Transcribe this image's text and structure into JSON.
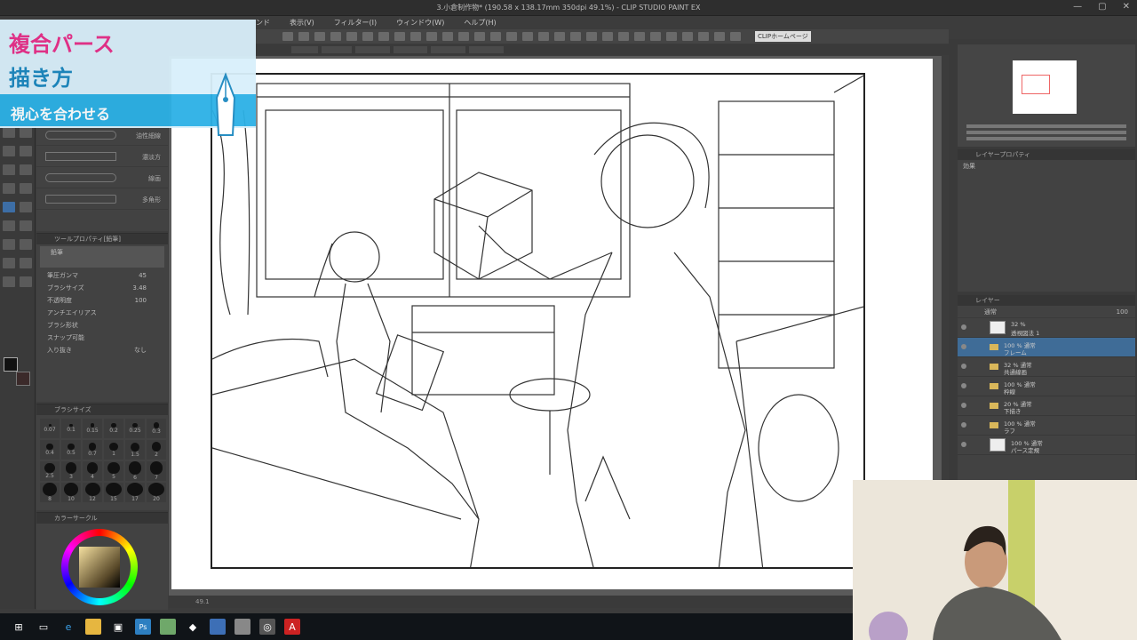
{
  "window": {
    "title": "3.小倉制作物* (190.58 x 138.17mm 350dpi 49.1%) - CLIP STUDIO PAINT EX",
    "controls": [
      "—",
      "▢",
      "✕"
    ]
  },
  "menu": {
    "items": [
      "ンド",
      "表示(V)",
      "フィルター(I)",
      "ウィンドウ(W)",
      "ヘルプ(H)"
    ]
  },
  "command_bar": {
    "clip_studio_label": "CLIPホームページ"
  },
  "overlay_card": {
    "line1": "複合パース",
    "line2": "描き方",
    "line3": "視心を合わせる"
  },
  "subtool_panel": {
    "brush_labels": [
      "油性細線",
      "濃淡方",
      "線画",
      "多角形"
    ]
  },
  "tool_property": {
    "header": "ツールプロパティ[鉛筆]",
    "preset": "鉛筆",
    "rows": [
      {
        "label": "筆圧ガンマ",
        "value": "45"
      },
      {
        "label": "ブラシサイズ",
        "value": "3.48"
      },
      {
        "label": "不透明度",
        "value": "100"
      },
      {
        "label": "アンチエイリアス",
        "value": ""
      },
      {
        "label": "ブラシ形状",
        "value": ""
      },
      {
        "label": "スナップ可能",
        "value": ""
      },
      {
        "label": "入り抜き",
        "value": "なし"
      }
    ]
  },
  "brush_size": {
    "header": "ブラシサイズ",
    "sizes": [
      "0.07",
      "0.1",
      "0.15",
      "0.2",
      "0.25",
      "0.3",
      "0.4",
      "0.5",
      "0.7",
      "1",
      "1.5",
      "2",
      "2.5",
      "3",
      "4",
      "5",
      "6",
      "7",
      "8",
      "10",
      "12",
      "15",
      "17",
      "20"
    ]
  },
  "color_panel": {
    "header": "カラーサークル"
  },
  "layer_property": {
    "header": "レイヤープロパティ",
    "effect_label": "効果"
  },
  "layers": {
    "header": "レイヤー",
    "blend_mode": "通常",
    "opacity": "100",
    "rows": [
      {
        "line1": "32 %",
        "line2": "透視図法 1",
        "selected": false
      },
      {
        "line1": "100 % 通常",
        "line2": "フレーム",
        "selected": true
      },
      {
        "line1": "32 % 通常",
        "line2": "共通線画",
        "selected": false
      },
      {
        "line1": "100 % 通常",
        "line2": "枠線",
        "selected": false
      },
      {
        "line1": "20 % 通常",
        "line2": "下描き",
        "selected": false
      },
      {
        "line1": "100 % 通常",
        "line2": "ラフ",
        "selected": false
      },
      {
        "line1": "100 % 通常",
        "line2": "パース定規",
        "selected": false
      }
    ]
  },
  "canvas": {
    "zoom": "49.1"
  },
  "taskbar": {
    "icons": [
      "windows-icon",
      "taskview-icon",
      "edge-icon",
      "explorer-icon",
      "store-icon",
      "maps-icon",
      "app-icon",
      "app-icon-2",
      "app-icon-3",
      "clip-studio-icon",
      "acrobat-icon"
    ]
  },
  "colors": {
    "accent_pink": "#e8308a",
    "accent_blue": "#1c88c0",
    "band_blue": "#2cb1e6",
    "layer_selected": "#3f6c97"
  }
}
